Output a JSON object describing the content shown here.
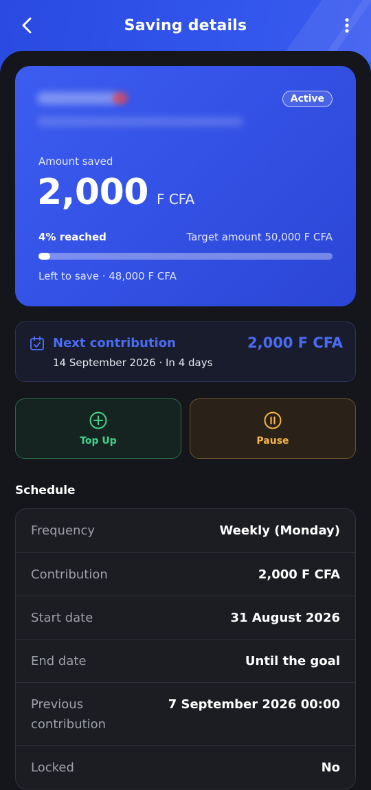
{
  "header": {
    "title": "Saving details"
  },
  "card": {
    "status_badge": "Active",
    "amount_label": "Amount saved",
    "amount_value": "2,000",
    "amount_unit": "F CFA",
    "progress_label": "4% reached",
    "progress_fraction": 0.04,
    "target_text": "Target amount 50,000 F CFA",
    "left_to_save": "Left to save · 48,000 F CFA"
  },
  "next_contribution": {
    "title": "Next contribution",
    "subtitle": "14 September 2026 · In 4 days",
    "amount": "2,000 F CFA"
  },
  "actions": {
    "top_up": "Top Up",
    "pause": "Pause"
  },
  "schedule": {
    "title": "Schedule",
    "rows": [
      {
        "key": "Frequency",
        "value": "Weekly (Monday)"
      },
      {
        "key": "Contribution",
        "value": "2,000 F CFA"
      },
      {
        "key": "Start date",
        "value": "31 August 2026"
      },
      {
        "key": "End date",
        "value": "Until the goal"
      },
      {
        "key": "Previous contribution",
        "value": "7 September 2026 00:00"
      },
      {
        "key": "Locked",
        "value": "No"
      }
    ]
  },
  "colors": {
    "accent": "#4a6cf5",
    "card_blue": "#3452e6",
    "success": "#3dd68c",
    "warning": "#f5b54a",
    "background": "#15161b"
  }
}
